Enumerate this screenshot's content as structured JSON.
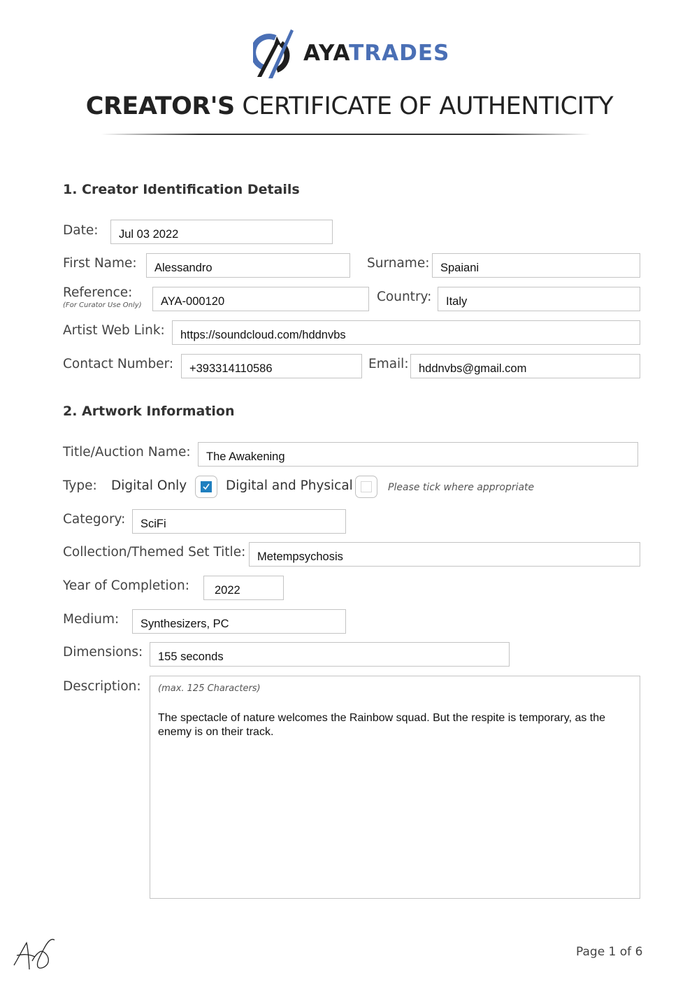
{
  "brand": {
    "logo_icon": "ayatrades-logo-icon",
    "name_dark": "AYA",
    "name_accent": "TRADES",
    "accent_color": "#4a6fb5"
  },
  "header": {
    "title_bold": "CREATOR'S",
    "title_light": "CERTIFICATE OF AUTHENTICITY"
  },
  "section1": {
    "heading": "1. Creator Identification Details",
    "date": {
      "label": "Date:",
      "value": "Jul 03 2022"
    },
    "first_name": {
      "label": "First Name:",
      "value": "Alessandro"
    },
    "surname": {
      "label": "Surname:",
      "value": "Spaiani"
    },
    "reference": {
      "label": "Reference:",
      "sublabel": "(For Curator Use Only)",
      "value": "AYA-000120"
    },
    "country": {
      "label": "Country:",
      "value": "Italy"
    },
    "web_link": {
      "label": "Artist Web Link:",
      "value": "https://soundcloud.com/hddnvbs"
    },
    "contact_number": {
      "label": "Contact Number:",
      "value": "+393314110586"
    },
    "email": {
      "label": "Email:",
      "value": "hddnvbs@gmail.com"
    }
  },
  "section2": {
    "heading": "2. Artwork Information",
    "title": {
      "label": "Title/Auction Name:",
      "value": "The Awakening"
    },
    "type": {
      "label": "Type:",
      "options": [
        {
          "label": "Digital Only",
          "checked": true
        },
        {
          "label": "Digital and Physical",
          "checked": false
        }
      ],
      "hint": "Please tick where appropriate",
      "check_color": "#1f7fbf"
    },
    "category": {
      "label": "Category:",
      "value": "SciFi"
    },
    "collection": {
      "label": "Collection/Themed Set Title:",
      "value": "Metempsychosis"
    },
    "year": {
      "label": "Year of Completion:",
      "value": "2022"
    },
    "medium": {
      "label": "Medium:",
      "value": "Synthesizers, PC"
    },
    "dimensions": {
      "label": "Dimensions:",
      "value": "155 seconds"
    },
    "description": {
      "label": "Description:",
      "hint": "(max. 125 Characters)",
      "value": "The spectacle of nature welcomes the Rainbow squad. But the respite is temporary, as the enemy is on their track."
    }
  },
  "footer": {
    "signature_initials": "AS",
    "page": "Page 1 of 6"
  }
}
